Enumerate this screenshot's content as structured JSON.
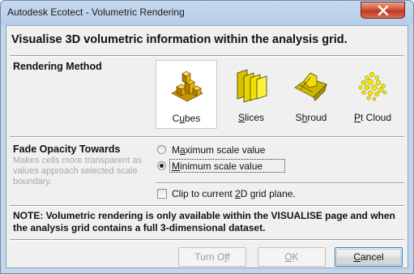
{
  "window": {
    "title": "Autodesk Ecotect - Volumetric Rendering"
  },
  "heading": "Visualise 3D volumetric information within the analysis grid.",
  "rendering_method": {
    "label": "Rendering Method",
    "options": [
      {
        "pre": "C",
        "ul": "u",
        "post": "bes",
        "icon": "cubes-icon",
        "selected": true
      },
      {
        "pre": "",
        "ul": "S",
        "post": "lices",
        "icon": "slices-icon",
        "selected": false
      },
      {
        "pre": "S",
        "ul": "h",
        "post": "roud",
        "icon": "shroud-icon",
        "selected": false
      },
      {
        "pre": "",
        "ul": "P",
        "post": "t Cloud",
        "icon": "point-cloud-icon",
        "selected": false
      }
    ]
  },
  "fade_opacity": {
    "label": "Fade Opacity Towards",
    "description": "Makes cells more transparent as values approach selected scale boundary.",
    "option_max": {
      "pre": "M",
      "ul": "a",
      "post": "ximum scale value",
      "selected": false
    },
    "option_min": {
      "pre": "",
      "ul": "M",
      "post": "inimum scale value",
      "selected": true
    }
  },
  "clip": {
    "pre": "Clip to current ",
    "ul": "2",
    "post": "D grid plane.",
    "checked": false
  },
  "note": "NOTE: Volumetric rendering is only available within the VISUALISE page and when the analysis grid contains a full 3-dimensional dataset.",
  "buttons": {
    "turn_off": {
      "pre": "Turn O",
      "ul": "f",
      "post": "f",
      "enabled": false
    },
    "ok": {
      "pre": "",
      "ul": "O",
      "post": "K",
      "enabled": false
    },
    "cancel": {
      "pre": "",
      "ul": "C",
      "post": "ancel",
      "enabled": true
    }
  },
  "colors": {
    "cubes": "#e8b400",
    "slices": "#f0e000",
    "shroud": "#d8c800",
    "points": "#f2e600",
    "close": "#c8462c"
  }
}
